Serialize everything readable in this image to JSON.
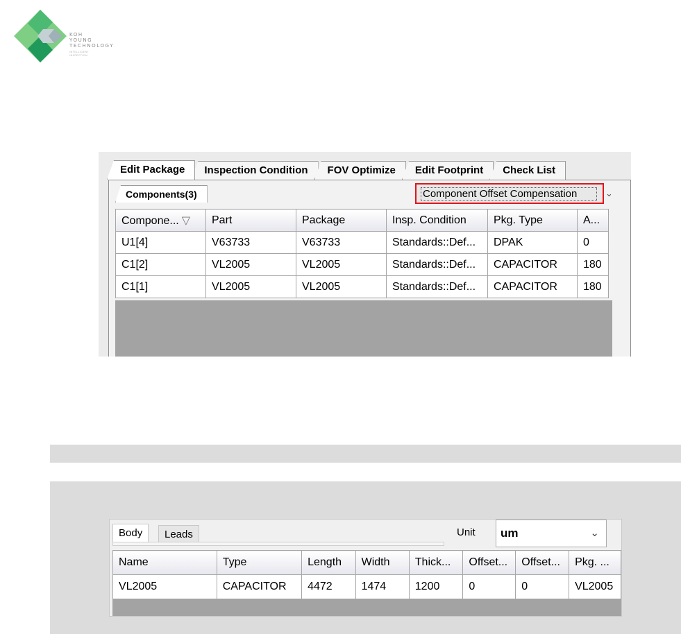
{
  "logo": {
    "line1": "KOH",
    "line2": "YOUNG",
    "line3": "TECHNOLOGY",
    "tagline1": "INTELLIGENT",
    "tagline2": "INSPECTION",
    "colors": {
      "green_light": "#7ecf83",
      "green_dark": "#1f9a5b",
      "gray": "#b8c4c8"
    }
  },
  "main_tabs": [
    "Edit Package",
    "Inspection Condition",
    "FOV Optimize",
    "Edit Footprint",
    "Check List"
  ],
  "components_tab": "Components(3)",
  "mode_dropdown": {
    "value": "Component Offset Compensation",
    "highlight_color": "#e1141b"
  },
  "components_table": {
    "columns": [
      "Compone...",
      "Part",
      "Package",
      "Insp. Condition",
      "Pkg. Type",
      "A..."
    ],
    "rows": [
      [
        "U1[4]",
        "V63733",
        "V63733",
        "Standards::Def...",
        "DPAK",
        "0"
      ],
      [
        "C1[2]",
        "VL2005",
        "VL2005",
        "Standards::Def...",
        "CAPACITOR",
        "180"
      ],
      [
        "C1[1]",
        "VL2005",
        "VL2005",
        "Standards::Def...",
        "CAPACITOR",
        "180"
      ]
    ]
  },
  "package_editor": {
    "tabs": [
      "Body",
      "Leads"
    ],
    "unit_label": "Unit",
    "unit_value": "um",
    "columns": [
      "Name",
      "Type",
      "Length",
      "Width",
      "Thick...",
      "Offset...",
      "Offset...",
      "Pkg. ..."
    ],
    "rows": [
      [
        "VL2005",
        "CAPACITOR",
        "4472",
        "1474",
        "1200",
        "0",
        "0",
        "VL2005"
      ]
    ]
  }
}
